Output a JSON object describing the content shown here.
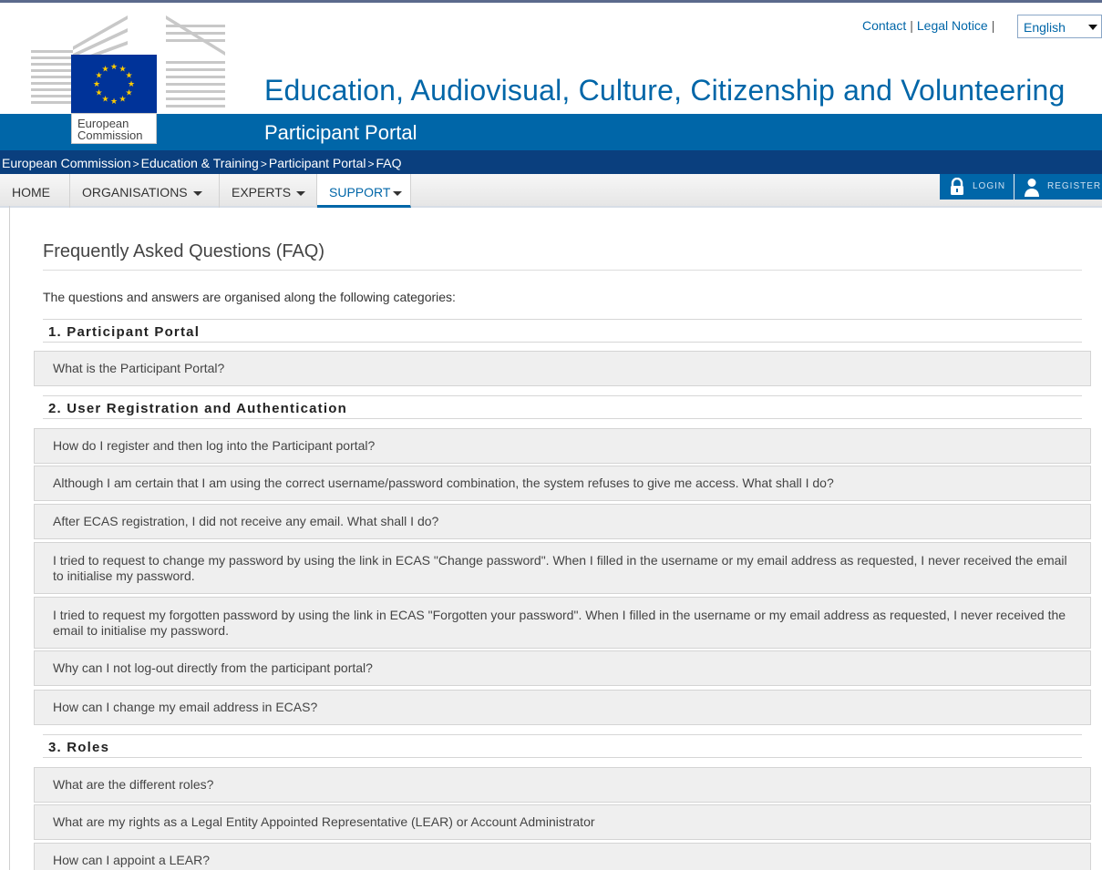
{
  "header": {
    "title": "Education, Audiovisual, Culture, Citizenship and Volunteering",
    "subtitle": "Participant Portal",
    "logo_line1": "European",
    "logo_line2": "Commission",
    "links": {
      "contact": "Contact",
      "legal": "Legal Notice",
      "sep": "|"
    },
    "language": "English"
  },
  "breadcrumb": {
    "items": [
      "European Commission",
      "Education & Training",
      "Participant Portal",
      "FAQ"
    ],
    "sep": ">"
  },
  "nav": {
    "items": [
      "HOME",
      "ORGANISATIONS",
      "EXPERTS",
      "SUPPORT"
    ],
    "login": "LOGIN",
    "register": "REGISTER"
  },
  "content": {
    "title": "Frequently Asked Questions (FAQ)",
    "intro": "The questions and answers are organised along the following categories:",
    "categories": [
      {
        "label": "1. Participant Portal",
        "questions": [
          "What is the Participant Portal?"
        ]
      },
      {
        "label": "2. User Registration and Authentication",
        "questions": [
          "How do I register and then log into the Participant portal?",
          "Although I am certain that I am using the correct username/password combination, the system refuses to give me access. What shall I do?",
          "After ECAS registration, I did not receive any email. What shall I do?",
          "I tried to request to change my password by using the link in ECAS \"Change password\". When I filled in the username or my email address as requested, I never received the email to initialise my password.",
          "I tried to request my forgotten password by using the link in ECAS \"Forgotten your password\". When I filled in the username or my email address as requested, I never received the email to initialise my password.",
          "Why can I not log-out directly from the participant portal?",
          "How can I change my email address in ECAS?"
        ]
      },
      {
        "label": "3. Roles",
        "questions": [
          "What are the different roles?",
          "What are my rights as a Legal Entity Appointed Representative (LEAR) or Account Administrator",
          "How can I appoint a LEAR?"
        ]
      }
    ]
  },
  "colors": {
    "brand_blue": "#0066a8",
    "breadcrumb_navy": "#0a3f7e",
    "flag_blue": "#003399",
    "flag_star": "#ffcc00"
  }
}
